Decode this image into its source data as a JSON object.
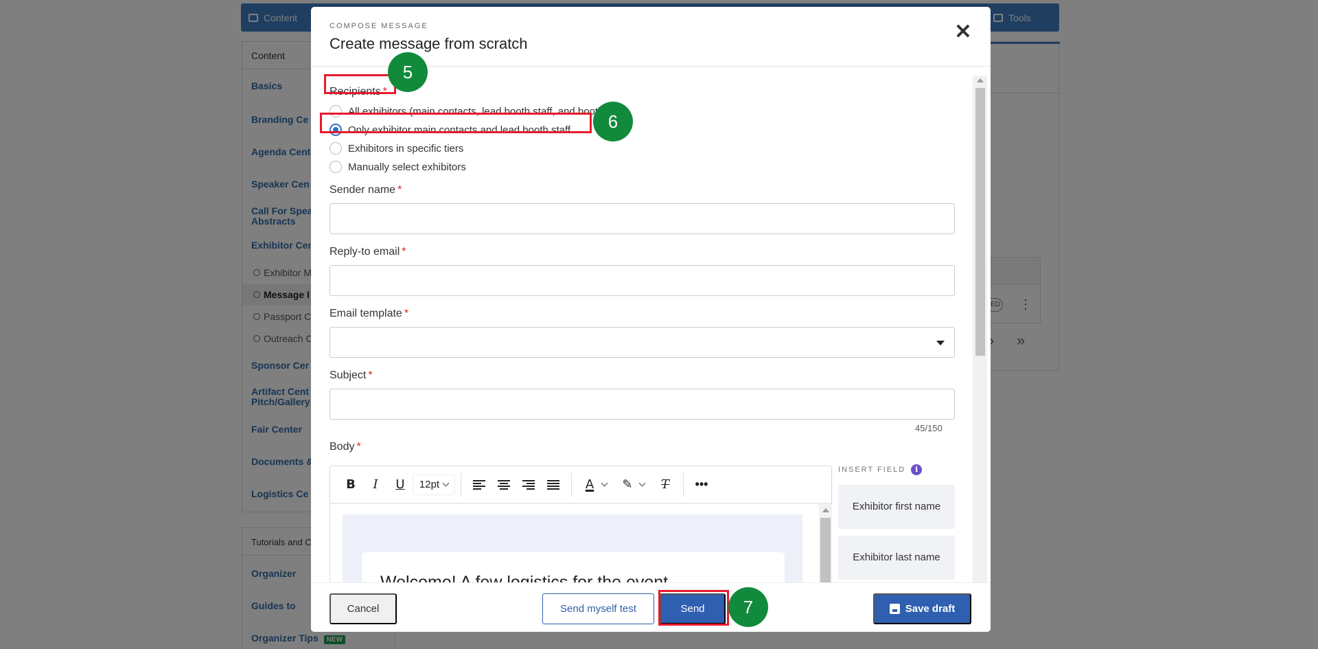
{
  "background": {
    "topbar": {
      "content_tab": "Content",
      "tools_tab": "Tools"
    },
    "sidebar": {
      "header": "Content",
      "items": [
        "Basics",
        "Branding Ce",
        "Agenda Cent",
        "Speaker Cen",
        "Call For Spea",
        "Abstracts",
        "Exhibitor Cen"
      ],
      "sub_items": [
        "Exhibitor M",
        "Message I",
        "Passport C",
        "Outreach C"
      ],
      "items2": [
        "Sponsor Cer",
        "Artifact Cent",
        "Pitch/Gallery",
        "Fair Center",
        "Documents &",
        "Logistics Ce"
      ]
    },
    "sidebar2": {
      "header": "Tutorials and C",
      "items": [
        "Organizer",
        "Guides to",
        "Organizer Tips"
      ],
      "new_badge": "NEW"
    },
    "right_panel": {
      "status_pill": "ED"
    }
  },
  "modal": {
    "eyebrow": "COMPOSE MESSAGE",
    "title": "Create message from scratch",
    "close_label": "✕",
    "recipients": {
      "label": "Recipients",
      "required_mark": "*",
      "options": [
        {
          "label": "All exhibitors (main contacts, lead booth staff, and booth staff)",
          "checked": false
        },
        {
          "label": "Only exhibitor main contacts and lead booth staff",
          "checked": true
        },
        {
          "label": "Exhibitors in specific tiers",
          "checked": false
        },
        {
          "label": "Manually select exhibitors",
          "checked": false
        }
      ]
    },
    "sender_name": {
      "label": "Sender name",
      "required_mark": "*",
      "value": ""
    },
    "reply_to": {
      "label": "Reply-to email",
      "required_mark": "*",
      "value": ""
    },
    "email_template": {
      "label": "Email template",
      "required_mark": "*",
      "value": ""
    },
    "subject": {
      "label": "Subject",
      "required_mark": "*",
      "value": "",
      "counter": "45/150"
    },
    "body": {
      "label": "Body",
      "required_mark": "*",
      "toolbar": {
        "font_size": "12pt"
      },
      "preview_heading": "Welcome! A few logistics for the event"
    },
    "insert_field": {
      "title": "INSERT FIELD",
      "info_glyph": "i",
      "fields": [
        "Exhibitor first name",
        "Exhibitor last name"
      ]
    },
    "footer": {
      "cancel": "Cancel",
      "send_test": "Send myself test",
      "send": "Send",
      "save_draft": "Save draft"
    }
  },
  "annotations": {
    "steps": [
      "5",
      "6",
      "7"
    ],
    "highlight_color": "#e8192c",
    "step_color": "#118a3b"
  },
  "colors": {
    "accent": "#2f5fb0",
    "header_blue": "#3e7cc0"
  }
}
